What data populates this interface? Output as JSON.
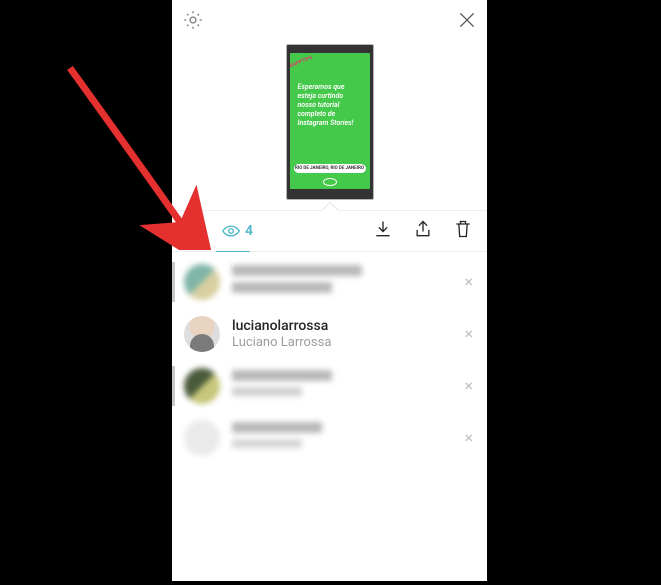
{
  "toolbar": {
    "view_count": "4"
  },
  "story": {
    "banner": "BAPPTIPS",
    "text": "Esperamos que esteja curtindo nosso tutorial completo de Instagram Stories!",
    "pill": "RIO DE JANEIRO, RIO DE JANEIRO"
  },
  "viewers": [
    {
      "username": "",
      "display": ""
    },
    {
      "username": "lucianolarrossa",
      "display": "Luciano Larrossa"
    },
    {
      "username": "",
      "display": ""
    },
    {
      "username": "",
      "display": ""
    }
  ]
}
